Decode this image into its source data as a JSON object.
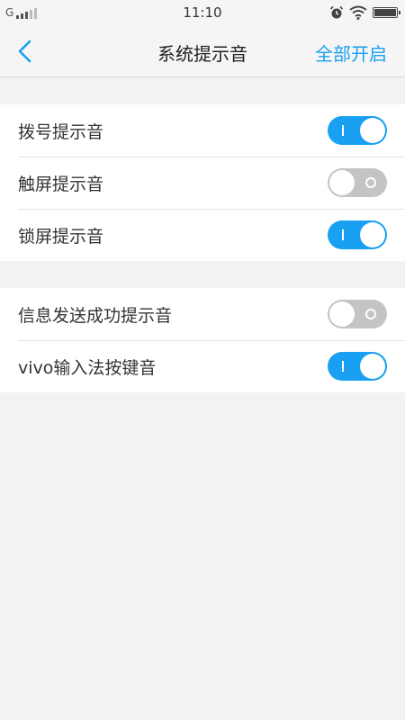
{
  "status_bar": {
    "carrier": "G",
    "time": "11:10",
    "icons": [
      "signal-icon",
      "alarm-icon",
      "wifi-icon",
      "battery-icon"
    ]
  },
  "nav": {
    "back_icon": "chevron-left-icon",
    "title": "系统提示音",
    "action_label": "全部开启"
  },
  "colors": {
    "accent": "#1aa0f2",
    "toggle_off": "#c4c4c4",
    "background": "#f2f2f2"
  },
  "groups": [
    {
      "items": [
        {
          "label": "拨号提示音",
          "on": true
        },
        {
          "label": "触屏提示音",
          "on": false
        },
        {
          "label": "锁屏提示音",
          "on": true
        }
      ]
    },
    {
      "items": [
        {
          "label": "信息发送成功提示音",
          "on": false
        },
        {
          "label": "vivo输入法按键音",
          "on": true
        }
      ]
    }
  ]
}
